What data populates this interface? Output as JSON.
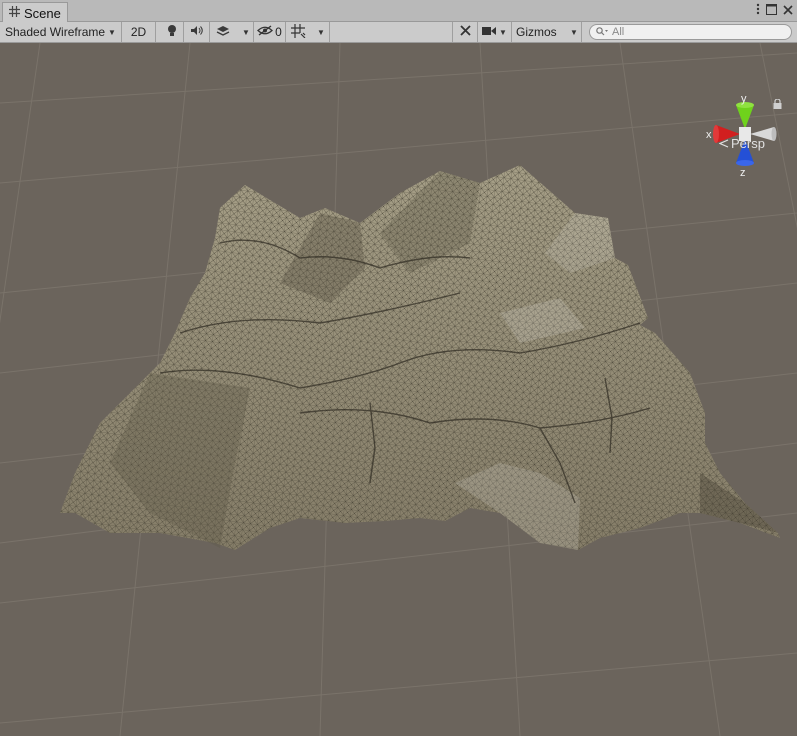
{
  "window": {
    "tab_label": "Scene",
    "tab_icon": "grid-icon",
    "controls": [
      "kebab-menu-icon",
      "maximize-icon",
      "close-icon"
    ]
  },
  "toolbar": {
    "draw_mode": "Shaded Wireframe",
    "toggle_2d": "2D",
    "lighting_icon": "lightbulb-icon",
    "audio_icon": "speaker-icon",
    "effects_icon": "layers-icon",
    "hidden_count": "0",
    "grid_icon": "grid-snap-icon",
    "tools_icon": "tools-icon",
    "camera_icon": "camera-icon",
    "gizmos": "Gizmos",
    "search_placeholder": "All"
  },
  "scene_gizmo": {
    "x_label": "x",
    "y_label": "y",
    "z_label": "z",
    "projection": "Persp",
    "colors": {
      "x": "#d21f1f",
      "y": "#6fd21c",
      "z": "#2450d6",
      "neutral": "#d9d9d9"
    }
  },
  "viewport": {
    "background": "#6b645c",
    "grid_color": "#7b746c",
    "terrain_color": "#8e8670"
  }
}
